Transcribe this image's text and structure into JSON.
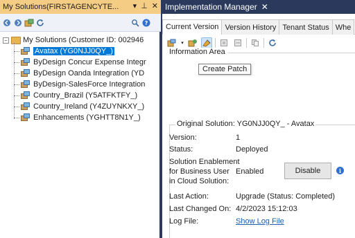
{
  "left_panel": {
    "title": "My Solutions(FIRSTAGENCYTE...",
    "title_controls": {
      "dropdown": "▾",
      "pin": "⊥",
      "close": "✕"
    },
    "root": {
      "label": "My Solutions (Customer ID: 002946"
    },
    "items": [
      {
        "label": "Avatax (YG0NJJ0QY_)",
        "selected": true
      },
      {
        "label": "ByDesign Concur Expense Integr"
      },
      {
        "label": "ByDesign Oanda Integration (YD"
      },
      {
        "label": "ByDesign-SalesForce Integration"
      },
      {
        "label": "Country_Brazil (Y5ATFKTFY_)"
      },
      {
        "label": "Country_Ireland (Y4ZUYNKXY_)"
      },
      {
        "label": "Enhancements (YGHTT8N1Y_)"
      }
    ]
  },
  "right_panel": {
    "title": "Implementation Manager",
    "close_glyph": "✕",
    "tabs": [
      {
        "label": "Current Version",
        "active": true
      },
      {
        "label": "Version History"
      },
      {
        "label": "Tenant Status"
      },
      {
        "label": "Whe"
      }
    ],
    "information_area_label": "Information Area",
    "tooltip": "Create Patch",
    "original_solution": {
      "legend": "Original Solution: YG0NJJ0QY_ - Avatax",
      "version_label": "Version:",
      "version_value": "1",
      "status_label": "Status:",
      "status_value": "Deployed",
      "enablement_label_1": "Solution Enablement",
      "enablement_label_2": "for Business User",
      "enablement_label_3": "in Cloud Solution:",
      "enablement_value": "Enabled",
      "disable_button": "Disable",
      "last_action_label": "Last Action:",
      "last_action_value": "Upgrade (Status: Completed)",
      "last_changed_label": "Last Changed On:",
      "last_changed_value": "4/2/2023 15:12:03",
      "log_file_label": "Log File:",
      "log_file_link": "Show Log File"
    }
  },
  "colors": {
    "left_title_bg": "#f5cc84",
    "right_title_bg": "#2b3a5c",
    "selection": "#0078d7",
    "link": "#1a5fb4"
  }
}
